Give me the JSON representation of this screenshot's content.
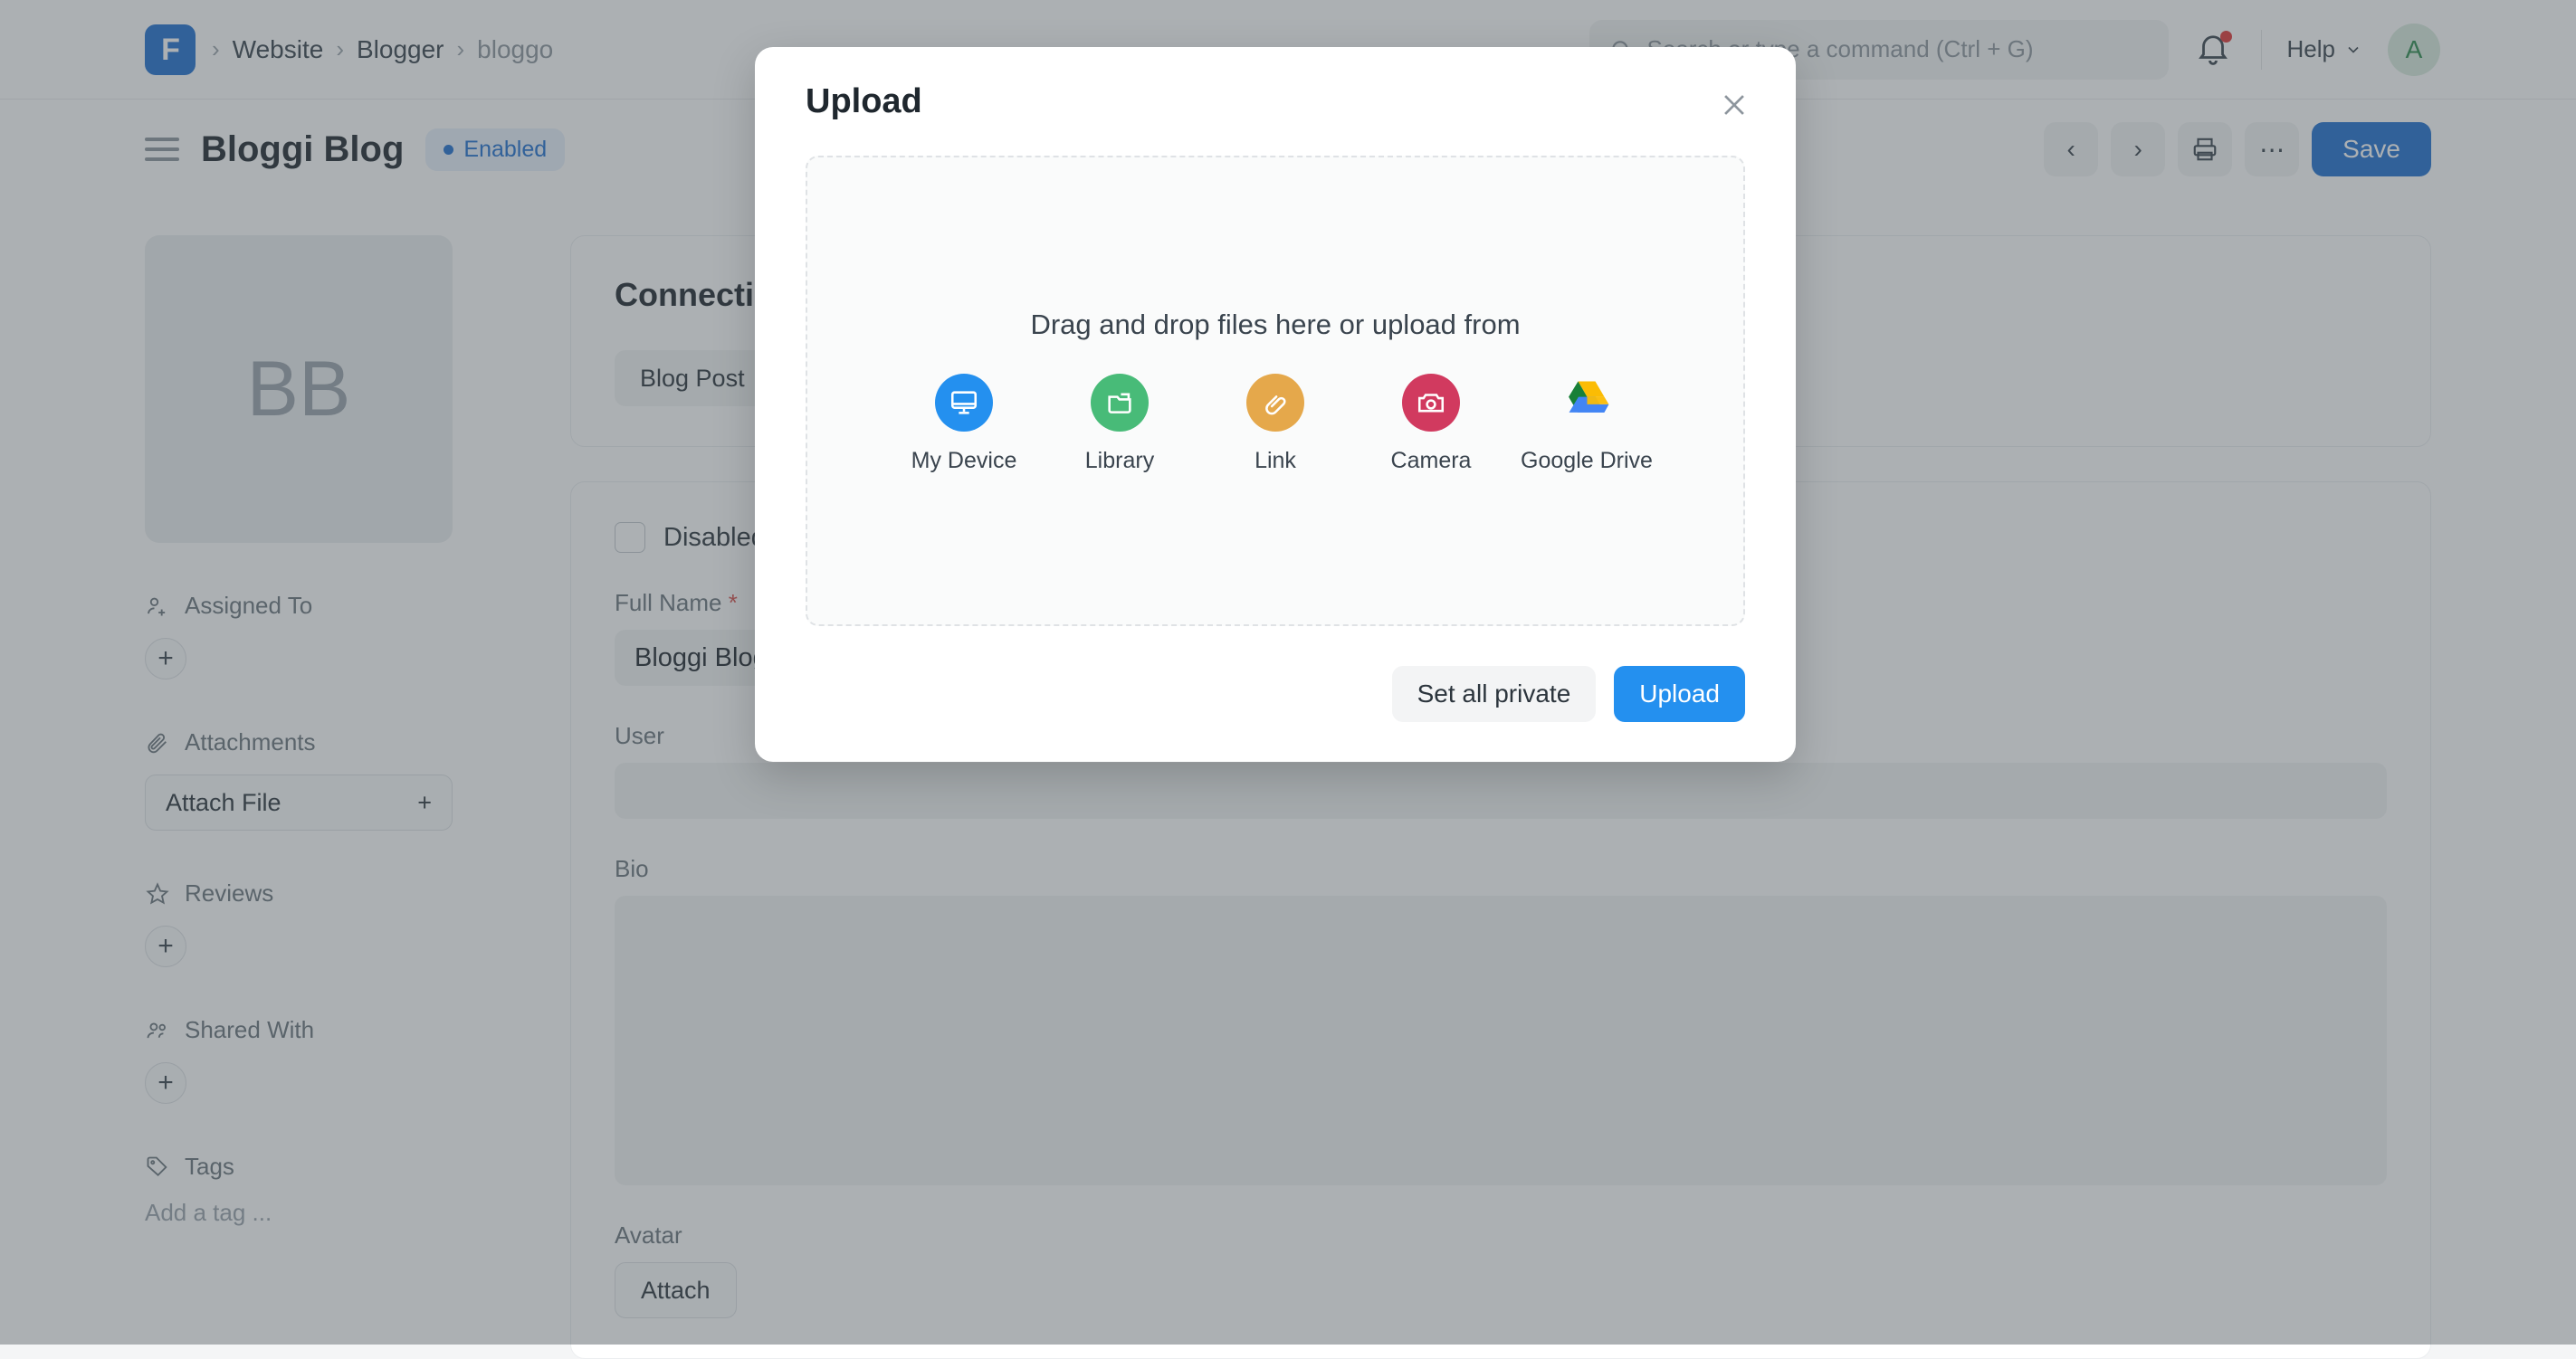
{
  "navbar": {
    "logo_glyph": "F",
    "breadcrumbs": [
      {
        "label": "Website",
        "muted": false
      },
      {
        "label": "Blogger",
        "muted": false
      },
      {
        "label": "bloggo",
        "muted": true
      }
    ],
    "separator": "›",
    "search_placeholder": "Search or type a command (Ctrl + G)",
    "help_label": "Help",
    "help_chevron": "∨",
    "avatar_initial": "A"
  },
  "page_header": {
    "title": "Bloggi Blog",
    "status_badge": "Enabled",
    "actions": {
      "prev": "‹",
      "next": "›",
      "print": "⎙",
      "more": "⋯",
      "save_label": "Save"
    }
  },
  "sidebar": {
    "avatar_initials": "BB",
    "sections": [
      {
        "label": "Assigned To",
        "icon": "user-plus-icon",
        "control": "plus"
      },
      {
        "label": "Attachments",
        "icon": "paperclip-icon",
        "control": "attach-file",
        "attach_label": "Attach File",
        "attach_plus": "+"
      },
      {
        "label": "Reviews",
        "icon": "star-icon",
        "control": "plus"
      },
      {
        "label": "Shared With",
        "icon": "users-icon",
        "control": "plus"
      },
      {
        "label": "Tags",
        "icon": "tag-icon",
        "control": "tag-input",
        "tag_placeholder": "Add a tag ..."
      }
    ],
    "plus_glyph": "+"
  },
  "connections": {
    "title": "Connections",
    "blog_post_label": "Blog Post",
    "add_glyph": "+"
  },
  "form": {
    "disabled_label": "Disabled",
    "disabled_checked": false,
    "fields": [
      {
        "label": "Full Name",
        "required": true,
        "value": "Bloggi Blog"
      },
      {
        "label": "User",
        "required": false,
        "value": ""
      },
      {
        "label": "Bio",
        "required": false,
        "value": ""
      },
      {
        "label": "Avatar",
        "required": false,
        "value": "",
        "button_label": "Attach"
      }
    ]
  },
  "modal": {
    "title": "Upload",
    "close_glyph": "×",
    "dropzone_text": "Drag and drop files here or upload from",
    "sources": [
      {
        "label": "My Device",
        "icon": "monitor-icon",
        "color": "#2490EF"
      },
      {
        "label": "Library",
        "icon": "folder-icon",
        "color": "#48BB78"
      },
      {
        "label": "Link",
        "icon": "paperclip-icon",
        "color": "#E5A84B"
      },
      {
        "label": "Camera",
        "icon": "camera-icon",
        "color": "#D13A5F"
      },
      {
        "label": "Google Drive",
        "icon": "google-drive-icon",
        "color": "#FBBC04"
      }
    ],
    "set_private_label": "Set all private",
    "upload_label": "Upload"
  },
  "colors": {
    "accent_blue": "#2490EF",
    "brand_blue": "#1F6FD0",
    "badge_blue": "#1f6fd0",
    "notification_red": "#E03636"
  }
}
